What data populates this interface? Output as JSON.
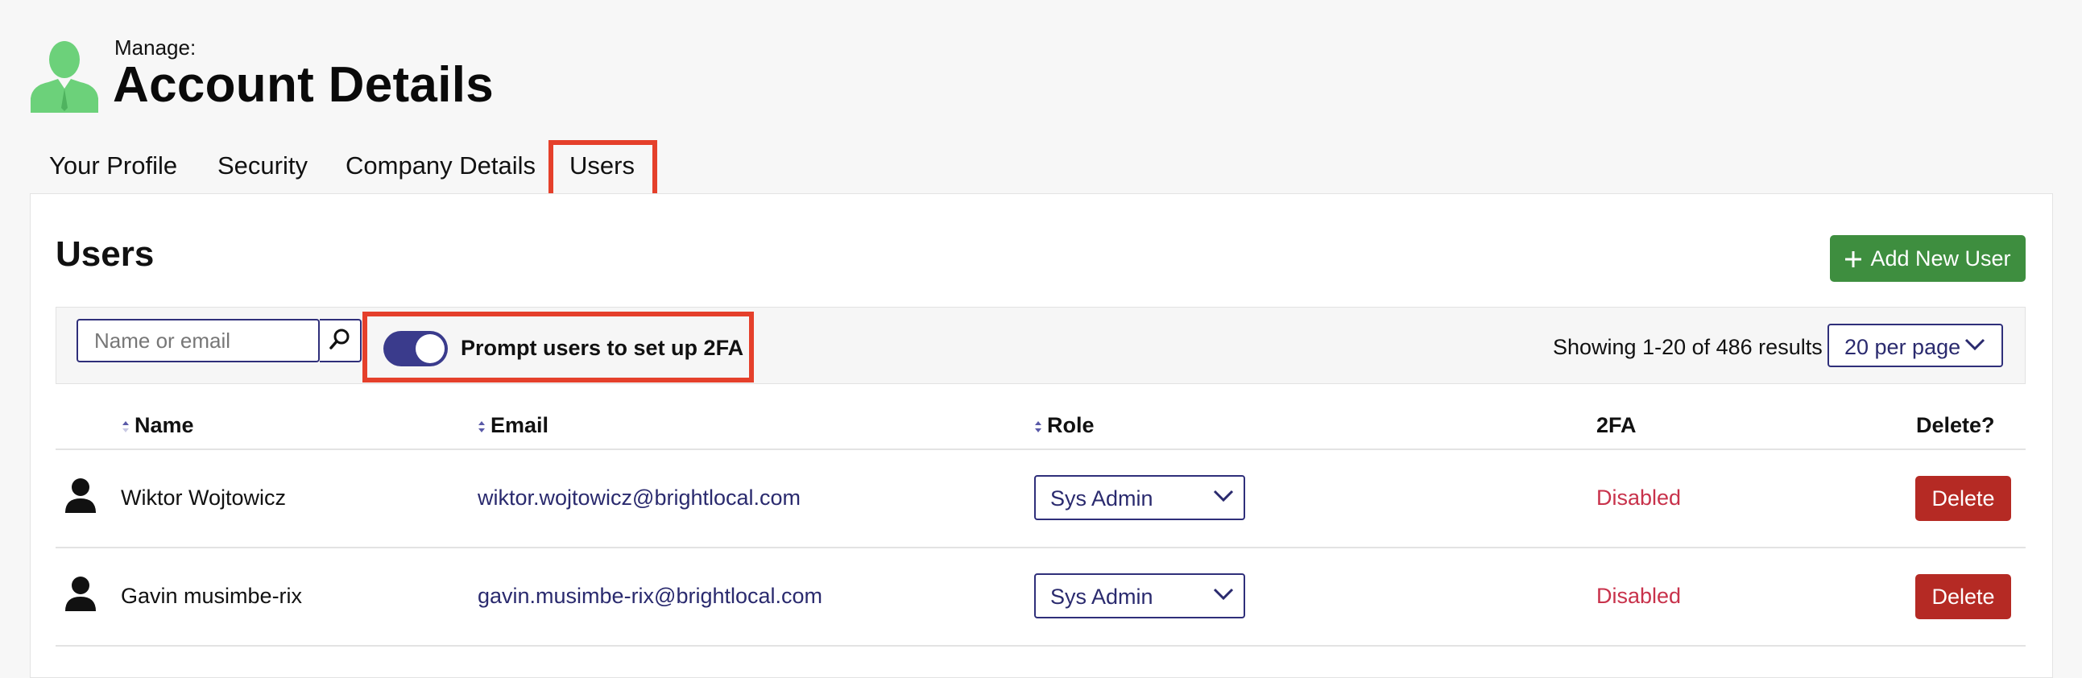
{
  "header": {
    "pre_title": "Manage:",
    "title": "Account Details",
    "icon": "user-silhouette-icon",
    "icon_color": "#6cd17a"
  },
  "tabs": [
    {
      "label": "Your Profile",
      "active": false
    },
    {
      "label": "Security",
      "active": false
    },
    {
      "label": "Company Details",
      "active": false
    },
    {
      "label": "Users",
      "active": true,
      "highlighted": true
    }
  ],
  "users_panel": {
    "title": "Users",
    "add_button": {
      "label": "Add New User",
      "icon": "plus-icon",
      "color": "#3e8e3f"
    },
    "search": {
      "placeholder": "Name or email",
      "value": "",
      "icon": "search-icon"
    },
    "two_fa_prompt": {
      "label": "Prompt users to set up 2FA",
      "enabled": true,
      "highlighted": true,
      "toggle_color": "#3a3b8c"
    },
    "results_text": "Showing 1-20 of 486 results",
    "per_page": {
      "selected": "20 per page"
    },
    "table": {
      "columns": [
        "Name",
        "Email",
        "Role",
        "2FA",
        "Delete?"
      ],
      "rows": [
        {
          "name": "Wiktor Wojtowicz",
          "email": "wiktor.wojtowicz@brightlocal.com",
          "role": "Sys Admin",
          "two_fa": "Disabled",
          "delete_label": "Delete"
        },
        {
          "name": "Gavin musimbe-rix",
          "email": "gavin.musimbe-rix@brightlocal.com",
          "role": "Sys Admin",
          "two_fa": "Disabled",
          "delete_label": "Delete"
        }
      ]
    }
  },
  "colors": {
    "highlight_border": "#e5402b",
    "link": "#2a2a6e",
    "disabled_status": "#c8324b",
    "delete_button": "#b52a24"
  }
}
